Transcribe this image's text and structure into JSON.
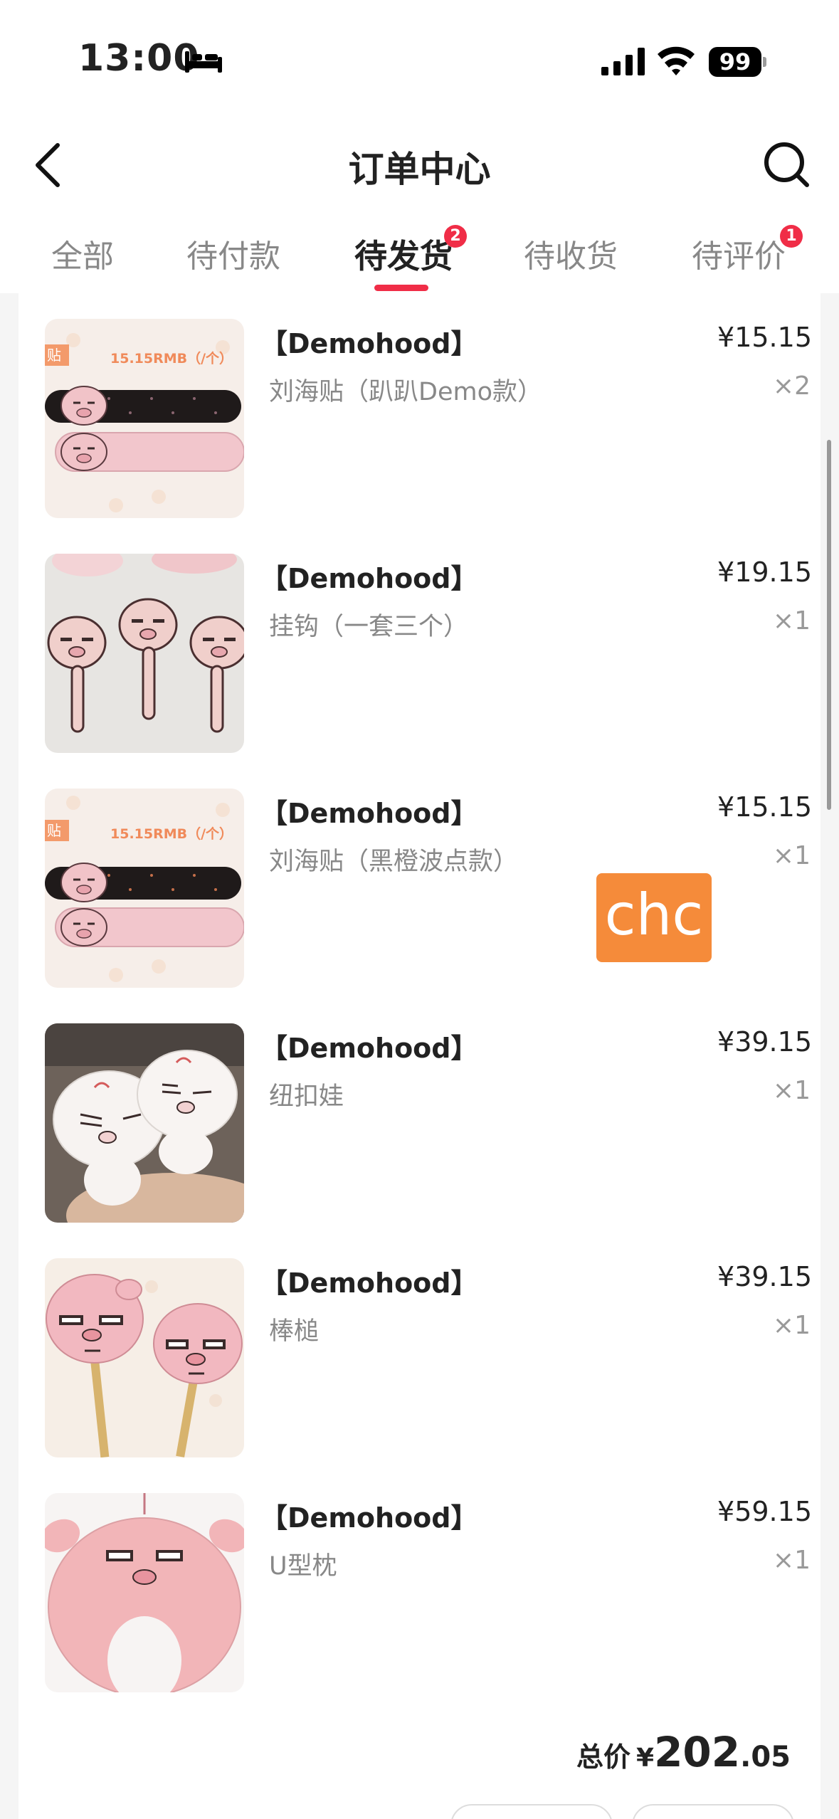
{
  "status_bar": {
    "time": "13:00",
    "battery": "99",
    "icons": [
      "bed-icon",
      "signal-icon",
      "wifi-icon",
      "battery-icon"
    ]
  },
  "nav": {
    "title": "订单中心",
    "icons": [
      "back-icon",
      "search-icon"
    ]
  },
  "tabs": [
    {
      "label": "全部"
    },
    {
      "label": "待付款"
    },
    {
      "label": "待发货",
      "badge": "2",
      "active": true
    },
    {
      "label": "待收货"
    },
    {
      "label": "待评价",
      "badge": "1"
    }
  ],
  "items": [
    {
      "brand": "【Demohood】",
      "name": "刘海贴（趴趴Demo款）",
      "price": "¥15.15",
      "qty": "×2",
      "thumb_text": "15.15RMB（/个）",
      "thumb_tag": "贴"
    },
    {
      "brand": "【Demohood】",
      "name": "挂钩（一套三个）",
      "price": "¥19.15",
      "qty": "×1"
    },
    {
      "brand": "【Demohood】",
      "name": "刘海贴（黑橙波点款）",
      "price": "¥15.15",
      "qty": "×1",
      "thumb_text": "15.15RMB（/个）",
      "thumb_tag": "贴"
    },
    {
      "brand": "【Demohood】",
      "name": "纽扣娃",
      "price": "¥39.15",
      "qty": "×1"
    },
    {
      "brand": "【Demohood】",
      "name": "棒槌",
      "price": "¥39.15",
      "qty": "×1"
    },
    {
      "brand": "【Demohood】",
      "name": "U型枕",
      "price": "¥59.15",
      "qty": "×1"
    }
  ],
  "watermark": "chc",
  "total": {
    "label": "总价",
    "currency": "¥",
    "integer": "202",
    "decimal": ".05"
  }
}
